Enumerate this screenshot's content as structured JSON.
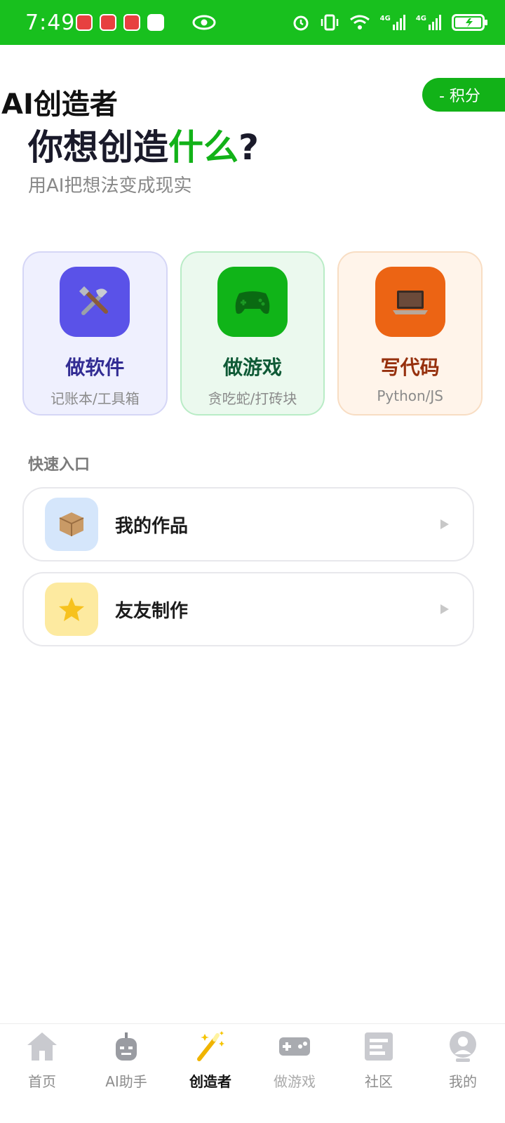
{
  "status_bar": {
    "time": "7:49",
    "network_1": "4G",
    "network_2": "4G"
  },
  "header": {
    "brand": "AI创造者",
    "points_label": "- 积分",
    "hero_title_prefix": "你想创造",
    "hero_title_accent": "什么",
    "hero_title_suffix": "?",
    "hero_subtitle": "用AI把想法变成现实"
  },
  "cards": [
    {
      "title": "做软件",
      "subtitle": "记账本/工具箱",
      "icon": "tools-icon"
    },
    {
      "title": "做游戏",
      "subtitle": "贪吃蛇/打砖块",
      "icon": "gamepad-icon"
    },
    {
      "title": "写代码",
      "subtitle": "Python/JS",
      "icon": "laptop-icon"
    }
  ],
  "quick_entry": {
    "title": "快速入口",
    "items": [
      {
        "label": "我的作品",
        "icon": "package-icon"
      },
      {
        "label": "友友制作",
        "icon": "star-icon"
      }
    ]
  },
  "bottom_nav": {
    "items": [
      {
        "label": "首页",
        "icon": "home-icon"
      },
      {
        "label": "AI助手",
        "icon": "robot-icon"
      },
      {
        "label": "创造者",
        "icon": "magic-wand-icon",
        "active": true
      },
      {
        "label": "做游戏",
        "icon": "gamepad-icon"
      },
      {
        "label": "社区",
        "icon": "community-icon"
      },
      {
        "label": "我的",
        "icon": "profile-icon"
      }
    ]
  },
  "colors": {
    "accent": "#12b218",
    "status_bar": "#18c01e"
  }
}
